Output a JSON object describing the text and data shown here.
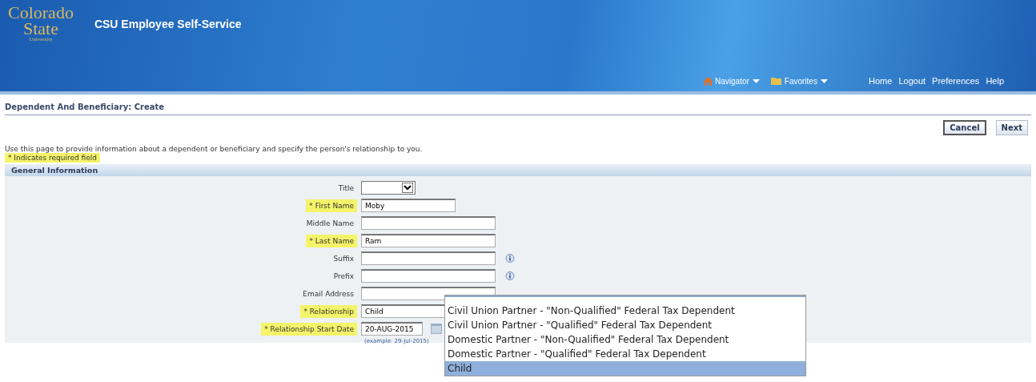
{
  "header": {
    "logo_lines": [
      "Colorado",
      "State",
      "University"
    ],
    "app_title": "CSU Employee Self-Service",
    "menus": [
      {
        "label": "Navigator",
        "kind": "home"
      },
      {
        "label": "Favorites",
        "kind": "folder"
      }
    ],
    "links": [
      "Home",
      "Logout",
      "Preferences",
      "Help"
    ]
  },
  "page_title": "Dependent And Beneficiary: Create",
  "buttons": [
    {
      "label": "Cancel",
      "default": true
    },
    {
      "label": "Next",
      "default": false
    }
  ],
  "intro": "Use this page to provide information about a dependent or beneficiary and specify the person's relationship to you.",
  "required_note": "* Indicates required field",
  "section_title": "General Information",
  "fields": [
    {
      "label": "Title",
      "required": false,
      "kind": "select"
    },
    {
      "label": "* First Name",
      "required": true,
      "kind": "short_text",
      "value": "Moby"
    },
    {
      "label": "Middle Name",
      "required": false,
      "kind": "text"
    },
    {
      "label": "* Last Name",
      "required": true,
      "kind": "text",
      "value": "Ram"
    },
    {
      "label": "Suffix",
      "required": false,
      "kind": "text",
      "info": true
    },
    {
      "label": "Prefix",
      "required": false,
      "kind": "text",
      "info": true
    },
    {
      "label": "Email Address",
      "required": false,
      "kind": "text"
    },
    {
      "label": "* Relationship",
      "required": true,
      "kind": "lov",
      "value": "Child"
    },
    {
      "label": "* Relationship Start Date",
      "required": true,
      "kind": "date",
      "value": "20-AUG-2015",
      "hint": "(example: 29-Jul-2015)"
    }
  ],
  "dropdown": [
    {
      "label": "Civil Union Partner - \"Non-Qualified\" Federal Tax Dependent",
      "selected": false
    },
    {
      "label": "Civil Union Partner - \"Qualified\" Federal Tax Dependent",
      "selected": false
    },
    {
      "label": "Domestic Partner - \"Non-Qualified\" Federal Tax Dependent",
      "selected": false
    },
    {
      "label": "Domestic Partner - \"Qualified\" Federal Tax Dependent",
      "selected": false
    },
    {
      "label": "Child",
      "selected": true
    }
  ]
}
